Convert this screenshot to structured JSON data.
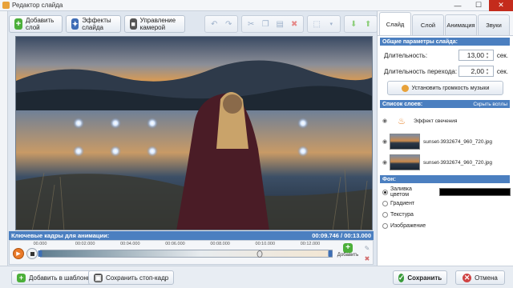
{
  "window": {
    "title": "Редактор слайда",
    "minimize": "—",
    "maximize": "☐",
    "close": "✕"
  },
  "toolbar": {
    "add_layer": "Добавить слой",
    "slide_effects": "Эффекты слайда",
    "camera_control": "Управление камерой",
    "icons": [
      "undo-icon",
      "redo-icon",
      "cut-icon",
      "copy-icon",
      "paste-icon",
      "delete-icon",
      "fit-icon",
      "move-down-icon",
      "move-up-icon"
    ]
  },
  "timeline": {
    "header": "Ключевые кадры для анимации:",
    "time": "00:09.746 / 00:13.000",
    "ticks": [
      "00.000",
      "00:02.000",
      "00:04.000",
      "00:06.000",
      "00:08.000",
      "00:10.000",
      "00:12.000"
    ],
    "tick_seconds": [
      0,
      2,
      4,
      6,
      8,
      10,
      12
    ],
    "total_seconds": 13,
    "current_seconds": 9.746,
    "keyframes_seconds": [
      0,
      13
    ],
    "add_label": "Добавить"
  },
  "bottom": {
    "add_to_templates": "Добавить в шаблоны",
    "save_still": "Сохранить стоп-кадр",
    "save": "Сохранить",
    "cancel": "Отмена"
  },
  "tabs": [
    "Слайд",
    "Слой",
    "Анимация",
    "Звуки"
  ],
  "active_tab": 0,
  "slide_params": {
    "header": "Общие параметры слайда:",
    "duration_label": "Длительность:",
    "duration_value": "13,00",
    "duration_unit": "сек.",
    "transition_label": "Длительность перехода:",
    "transition_value": "2,00",
    "transition_unit": "сек.",
    "music_button": "Установить громкость музыки"
  },
  "layers": {
    "header": "Список слоев:",
    "hide_all": "Скрыть всплы",
    "items": [
      "Эффект свечения",
      "sunset-3932674_960_720.jpg",
      "sunset-3932674_960_720.jpg"
    ]
  },
  "background": {
    "header": "Фон:",
    "options": [
      "Заливка цветом",
      "Градиент",
      "Текстура",
      "Изображение"
    ],
    "selected": 0,
    "fill_color": "#000000"
  }
}
